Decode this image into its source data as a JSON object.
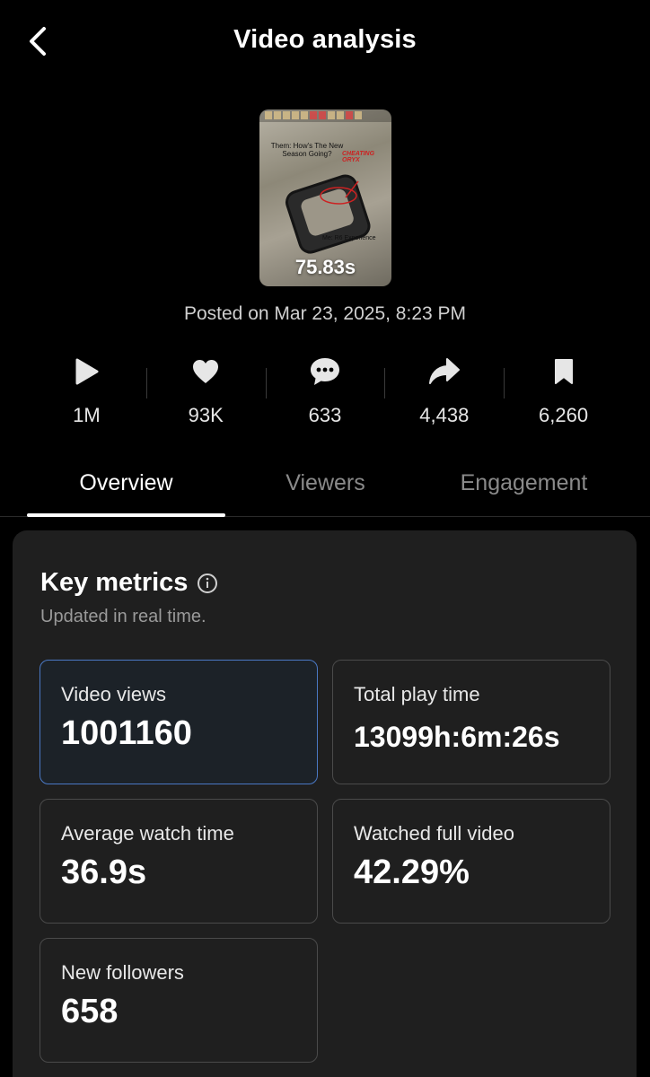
{
  "header": {
    "title": "Video analysis"
  },
  "video": {
    "duration": "75.83s",
    "caption_text": "Them: How's The New Season Going?",
    "tag_text": "CHEATING ORYX",
    "sub_text": "Me: R6 Experience",
    "posted": "Posted on Mar 23, 2025, 8:23 PM"
  },
  "stats": [
    {
      "icon": "play-icon",
      "value": "1M"
    },
    {
      "icon": "heart-icon",
      "value": "93K"
    },
    {
      "icon": "comment-icon",
      "value": "633"
    },
    {
      "icon": "share-icon",
      "value": "4,438"
    },
    {
      "icon": "bookmark-icon",
      "value": "6,260"
    }
  ],
  "tabs": [
    {
      "label": "Overview",
      "active": true
    },
    {
      "label": "Viewers",
      "active": false
    },
    {
      "label": "Engagement",
      "active": false
    }
  ],
  "key_metrics": {
    "title": "Key metrics",
    "subtitle": "Updated in real time.",
    "items": [
      {
        "label": "Video views",
        "value": "1001160",
        "selected": true
      },
      {
        "label": "Total play time",
        "value": "13099h:6m:26s",
        "selected": false
      },
      {
        "label": "Average watch time",
        "value": "36.9s",
        "selected": false
      },
      {
        "label": "Watched full video",
        "value": "42.29%",
        "selected": false
      },
      {
        "label": "New followers",
        "value": "658",
        "selected": false
      }
    ]
  },
  "colors": {
    "background": "#000000",
    "card": "#1f1f1f",
    "selected_border": "#4a78c4",
    "muted_text": "#8a8a8a"
  }
}
